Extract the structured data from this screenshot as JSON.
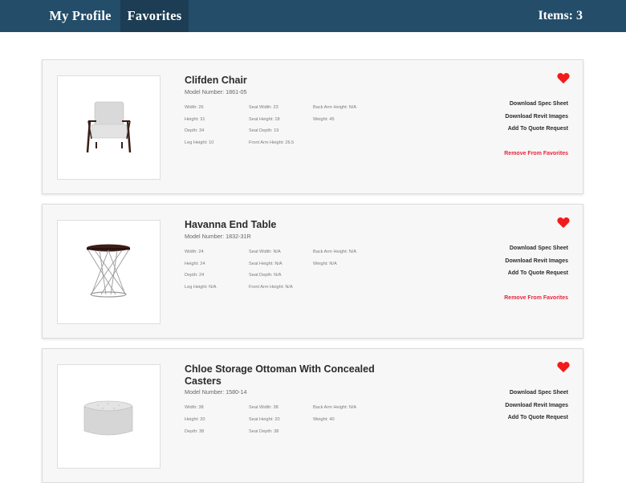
{
  "nav": {
    "profile_label": "My Profile",
    "favorites_label": "Favorites",
    "items_count": "Items: 3"
  },
  "colors": {
    "nav_background": "#244d69",
    "nav_active": "#1c3d54",
    "heart": "#f21b1b",
    "remove_link": "#e8253a"
  },
  "actions": {
    "spec_sheet": "Download Spec Sheet",
    "revit_images": "Download Revit Images",
    "quote_request": "Add To Quote Request",
    "remove": "Remove From Favorites"
  },
  "products": [
    {
      "name": "Clifden Chair",
      "model": "Model Number: 1861-05",
      "icon": "armchair",
      "specs": [
        [
          "Width: 26",
          "Seat Width: 23",
          "Back Arm Height: N/A"
        ],
        [
          "Height: 31",
          "Seat Height: 18",
          "Weight: 45"
        ],
        [
          "Depth: 34",
          "Seat Depth: 19",
          ""
        ],
        [
          "Leg Height: 10",
          "Front Arm Height: 26.5",
          ""
        ]
      ]
    },
    {
      "name": "Havanna End Table",
      "model": "Model Number: 1832-31R",
      "icon": "end-table",
      "specs": [
        [
          "Width: 24",
          "Seat Width: N/A",
          "Back Arm Height: N/A"
        ],
        [
          "Height: 24",
          "Seat Height: N/A",
          "Weight: N/A"
        ],
        [
          "Depth: 24",
          "Seat Depth: N/A",
          ""
        ],
        [
          "Leg Height: N/A",
          "Front Arm Height: N/A",
          ""
        ]
      ]
    },
    {
      "name": "Chloe Storage Ottoman With Concealed Casters",
      "model": "Model Number: 1580-14",
      "icon": "ottoman",
      "specs": [
        [
          "Width: 38",
          "Seat Width: 38",
          "Back Arm Height: N/A"
        ],
        [
          "Height: 20",
          "Seat Height: 20",
          "Weight: 40"
        ],
        [
          "Depth: 38",
          "Seat Depth: 38",
          ""
        ]
      ]
    }
  ]
}
